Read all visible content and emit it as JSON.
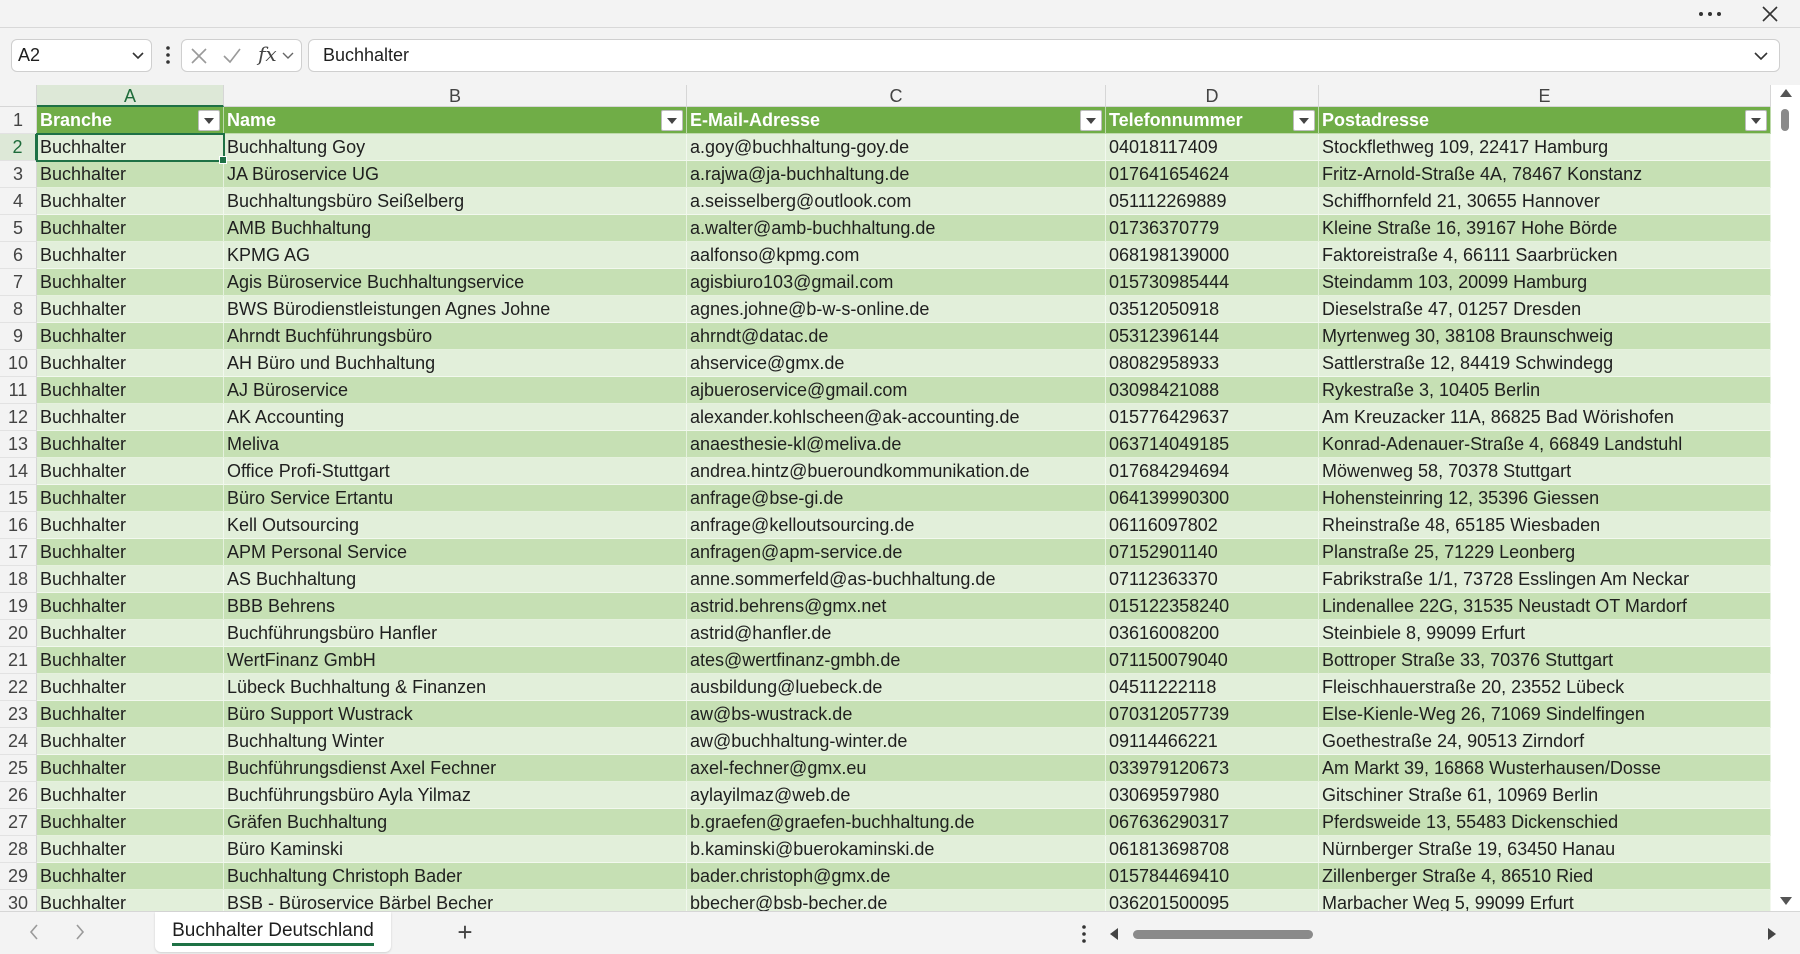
{
  "window": {
    "more_icon": "more-horizontal-icon",
    "close_icon": "close-icon"
  },
  "formula_bar": {
    "name_box": "A2",
    "function_label": "fx",
    "value": "Buchhalter"
  },
  "columns": [
    "A",
    "B",
    "C",
    "D",
    "E"
  ],
  "header_row": {
    "row_number": "1",
    "cells": [
      "Branche",
      "Name",
      "E-Mail-Adresse",
      "Telefonnummer",
      "Postadresse"
    ]
  },
  "rows": [
    {
      "n": "2",
      "cells": [
        "Buchhalter",
        "Buchhaltung Goy",
        "a.goy@buchhaltung-goy.de",
        "04018117409",
        "Stockflethweg 109, 22417 Hamburg"
      ]
    },
    {
      "n": "3",
      "cells": [
        "Buchhalter",
        "JA Büroservice UG",
        "a.rajwa@ja-buchhaltung.de",
        "017641654624",
        "Fritz-Arnold-Straße 4A, 78467 Konstanz"
      ]
    },
    {
      "n": "4",
      "cells": [
        "Buchhalter",
        "Buchhaltungsbüro Seißelberg",
        "a.seisselberg@outlook.com",
        "051112269889",
        "Schiffhornfeld 21, 30655 Hannover"
      ]
    },
    {
      "n": "5",
      "cells": [
        "Buchhalter",
        "AMB Buchhaltung",
        "a.walter@amb-buchhaltung.de",
        "01736370779",
        "Kleine Straße 16, 39167 Hohe Börde"
      ]
    },
    {
      "n": "6",
      "cells": [
        "Buchhalter",
        "KPMG AG",
        "aalfonso@kpmg.com",
        "068198139000",
        "Faktoreistraße 4, 66111 Saarbrücken"
      ]
    },
    {
      "n": "7",
      "cells": [
        "Buchhalter",
        "Agis Büroservice Buchhaltungservice",
        "agisbiuro103@gmail.com",
        "015730985444",
        "Steindamm 103, 20099 Hamburg"
      ]
    },
    {
      "n": "8",
      "cells": [
        "Buchhalter",
        "BWS Bürodienstleistungen Agnes Johne",
        "agnes.johne@b-w-s-online.de",
        "03512050918",
        "Dieselstraße 47, 01257 Dresden"
      ]
    },
    {
      "n": "9",
      "cells": [
        "Buchhalter",
        "Ahrndt Buchführungsbüro",
        "ahrndt@datac.de",
        "05312396144",
        "Myrtenweg 30, 38108 Braunschweig"
      ]
    },
    {
      "n": "10",
      "cells": [
        "Buchhalter",
        "AH Büro und Buchhaltung",
        "ahservice@gmx.de",
        "08082958933",
        "Sattlerstraße 12, 84419 Schwindegg"
      ]
    },
    {
      "n": "11",
      "cells": [
        "Buchhalter",
        "AJ Büroservice",
        "ajbueroservice@gmail.com",
        "03098421088",
        "Rykestraße 3, 10405 Berlin"
      ]
    },
    {
      "n": "12",
      "cells": [
        "Buchhalter",
        "AK Accounting",
        "alexander.kohlscheen@ak-accounting.de",
        "015776429637",
        "Am Kreuzacker 11A, 86825 Bad Wörishofen"
      ]
    },
    {
      "n": "13",
      "cells": [
        "Buchhalter",
        "Meliva",
        "anaesthesie-kl@meliva.de",
        "063714049185",
        "Konrad-Adenauer-Straße 4, 66849 Landstuhl"
      ]
    },
    {
      "n": "14",
      "cells": [
        "Buchhalter",
        "Office Profi-Stuttgart",
        "andrea.hintz@bueroundkommunikation.de",
        "017684294694",
        "Möwenweg 58, 70378 Stuttgart"
      ]
    },
    {
      "n": "15",
      "cells": [
        "Buchhalter",
        "Büro Service Ertantu",
        "anfrage@bse-gi.de",
        "064139990300",
        "Hohensteinring 12, 35396 Giessen"
      ]
    },
    {
      "n": "16",
      "cells": [
        "Buchhalter",
        "Kell Outsourcing",
        "anfrage@kelloutsourcing.de",
        "06116097802",
        "Rheinstraße 48, 65185 Wiesbaden"
      ]
    },
    {
      "n": "17",
      "cells": [
        "Buchhalter",
        "APM Personal Service",
        "anfragen@apm-service.de",
        "07152901140",
        "Planstraße 25, 71229 Leonberg"
      ]
    },
    {
      "n": "18",
      "cells": [
        "Buchhalter",
        "AS Buchhaltung",
        "anne.sommerfeld@as-buchhaltung.de",
        "07112363370",
        "Fabrikstraße 1/1, 73728 Esslingen Am Neckar"
      ]
    },
    {
      "n": "19",
      "cells": [
        "Buchhalter",
        "BBB Behrens",
        "astrid.behrens@gmx.net",
        "015122358240",
        "Lindenallee 22G, 31535 Neustadt OT Mardorf"
      ]
    },
    {
      "n": "20",
      "cells": [
        "Buchhalter",
        "Buchführungsbüro Hanfler",
        "astrid@hanfler.de",
        "03616008200",
        "Steinbiele 8, 99099 Erfurt"
      ]
    },
    {
      "n": "21",
      "cells": [
        "Buchhalter",
        "WertFinanz GmbH",
        "ates@wertfinanz-gmbh.de",
        "071150079040",
        "Bottroper Straße 33, 70376 Stuttgart"
      ]
    },
    {
      "n": "22",
      "cells": [
        "Buchhalter",
        "Lübeck Buchhaltung & Finanzen",
        "ausbildung@luebeck.de",
        "04511222118",
        "Fleischhauerstraße 20, 23552 Lübeck"
      ]
    },
    {
      "n": "23",
      "cells": [
        "Buchhalter",
        "Büro Support Wustrack",
        "aw@bs-wustrack.de",
        "070312057739",
        "Else-Kienle-Weg 26, 71069 Sindelfingen"
      ]
    },
    {
      "n": "24",
      "cells": [
        "Buchhalter",
        "Buchhaltung Winter",
        "aw@buchhaltung-winter.de",
        "09114466221",
        "Goethestraße 24, 90513 Zirndorf"
      ]
    },
    {
      "n": "25",
      "cells": [
        "Buchhalter",
        "Buchführungsdienst Axel Fechner",
        "axel-fechner@gmx.eu",
        "033979120673",
        "Am Markt 39, 16868 Wusterhausen/Dosse"
      ]
    },
    {
      "n": "26",
      "cells": [
        "Buchhalter",
        "Buchführungsbüro Ayla Yilmaz",
        "aylayilmaz@web.de",
        "03069597980",
        "Gitschiner Straße 61, 10969 Berlin"
      ]
    },
    {
      "n": "27",
      "cells": [
        "Buchhalter",
        "Gräfen Buchhaltung",
        "b.graefen@graefen-buchhaltung.de",
        "067636290317",
        "Pferdsweide 13, 55483 Dickenschied"
      ]
    },
    {
      "n": "28",
      "cells": [
        "Buchhalter",
        "Büro Kaminski",
        "b.kaminski@buerokaminski.de",
        "061813698708",
        "Nürnberger Straße 19, 63450 Hanau"
      ]
    },
    {
      "n": "29",
      "cells": [
        "Buchhalter",
        "Buchhaltung Christoph Bader",
        "bader.christoph@gmx.de",
        "015784469410",
        "Zillenberger Straße 4, 86510 Ried"
      ]
    },
    {
      "n": "30",
      "cells": [
        "Buchhalter",
        "BSB - Büroservice Bärbel Becher",
        "bbecher@bsb-becher.de",
        "036201500095",
        "Marbacher Weg 5, 99099 Erfurt"
      ]
    }
  ],
  "sheet_tabs": {
    "active": "Buchhalter Deutschland",
    "add_label": "+"
  },
  "colors": {
    "header_fill": "#70ad47",
    "band_dark": "#c6e0b4",
    "band_light": "#e2efda",
    "accent": "#1e7145"
  }
}
